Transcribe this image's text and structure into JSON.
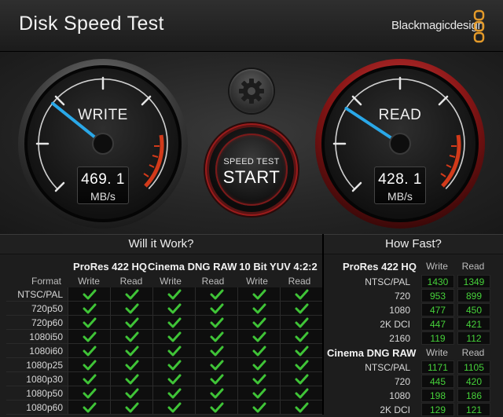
{
  "window": {
    "title": "Disk Speed Test",
    "brand": "Blackmagicdesign"
  },
  "colors": {
    "accent_blue": "#2aa8e8",
    "read_ring": "#b01c1c",
    "check_green": "#3fc437",
    "number_green": "#46d13a",
    "redline": "#d23a1a"
  },
  "gauges": {
    "write": {
      "label": "WRITE",
      "value": "469. 1",
      "unit": "MB/s",
      "level": 0.31
    },
    "read": {
      "label": "READ",
      "value": "428. 1",
      "unit": "MB/s",
      "level": 0.29
    }
  },
  "controls": {
    "settings_icon": "gear-icon",
    "start_top": "SPEED TEST",
    "start_main": "START"
  },
  "will_it_work": {
    "title": "Will it Work?",
    "format_header": "Format",
    "groups": [
      "ProRes 422 HQ",
      "Cinema DNG RAW",
      "10 Bit YUV 4:2:2"
    ],
    "subheaders": [
      "Write",
      "Read",
      "Write",
      "Read",
      "Write",
      "Read"
    ],
    "rows": [
      "NTSC/PAL",
      "720p50",
      "720p60",
      "1080i50",
      "1080i60",
      "1080p25",
      "1080p30",
      "1080p50",
      "1080p60"
    ],
    "check_icon": "check-icon"
  },
  "how_fast": {
    "title": "How Fast?",
    "col_write": "Write",
    "col_read": "Read",
    "groups": [
      {
        "name": "ProRes 422 HQ",
        "rows": [
          {
            "label": "NTSC/PAL",
            "write": "1430",
            "read": "1349"
          },
          {
            "label": "720",
            "write": "953",
            "read": "899"
          },
          {
            "label": "1080",
            "write": "477",
            "read": "450"
          },
          {
            "label": "2K DCI",
            "write": "447",
            "read": "421"
          },
          {
            "label": "2160",
            "write": "119",
            "read": "112"
          }
        ]
      },
      {
        "name": "Cinema DNG RAW",
        "rows": [
          {
            "label": "NTSC/PAL",
            "write": "1171",
            "read": "1105"
          },
          {
            "label": "720",
            "write": "445",
            "read": "420"
          },
          {
            "label": "1080",
            "write": "198",
            "read": "186"
          },
          {
            "label": "2K DCI",
            "write": "129",
            "read": "121"
          }
        ]
      }
    ]
  }
}
